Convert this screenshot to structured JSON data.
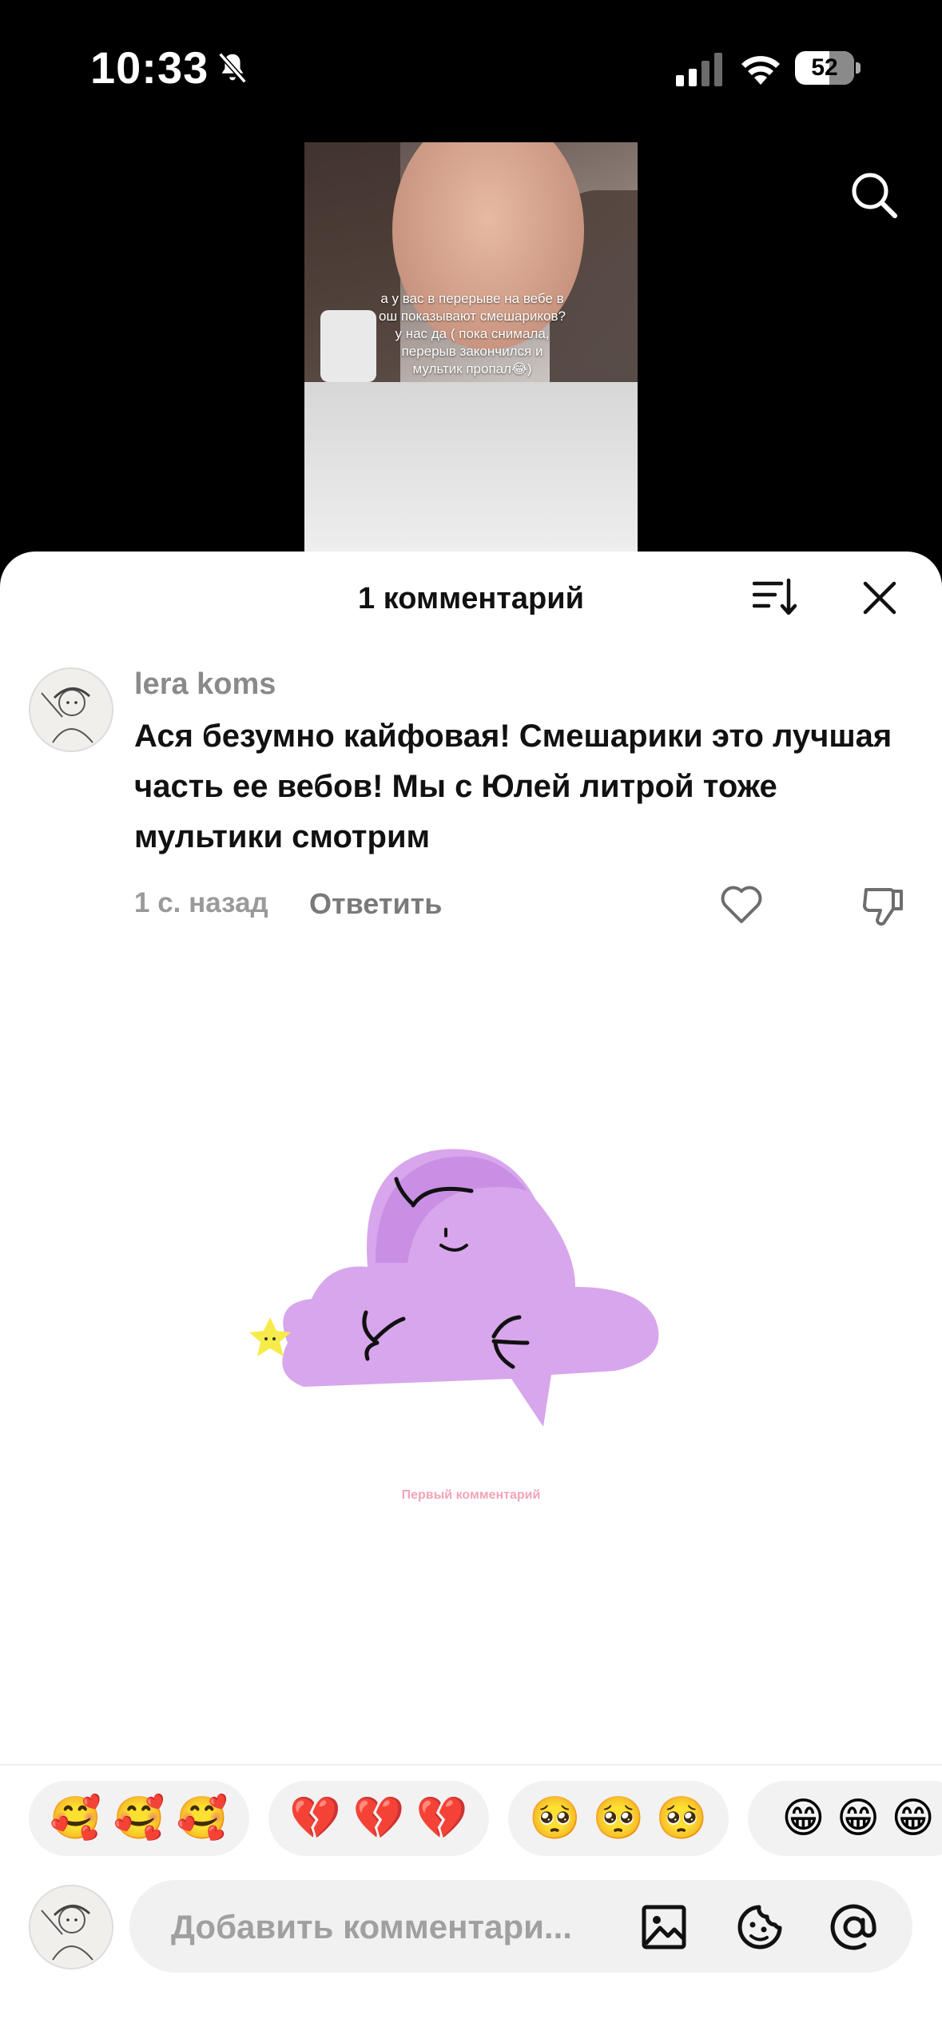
{
  "status_bar": {
    "time": "10:33",
    "battery": "52"
  },
  "video": {
    "caption": "а у вас в перерыве на вебе в ош показывают смешариков? у нас да ( пока снимала, перерыв закончился и мультик пропал😂)"
  },
  "comments_sheet": {
    "title": "1 комментарий",
    "comments": [
      {
        "username": "lera koms",
        "text": "Ася безумно кайфовая! Смешарики это лучшая часть ее вебов! Мы с Юлей литрой тоже мультики смотрим",
        "time": "1 с. назад",
        "reply_label": "Ответить"
      }
    ],
    "first_comment_label": "Первый комментарий"
  },
  "emoji_suggestions": [
    "🥰 🥰 🥰",
    "💔 💔 💔",
    "🥺 🥺 🥺",
    "😁 😁 😁"
  ],
  "composer": {
    "placeholder": "Добавить комментари..."
  },
  "icons": {
    "mute": "bell-slash-icon",
    "search": "search-icon",
    "sort": "sort-icon",
    "close": "close-icon",
    "like": "heart-icon",
    "dislike": "thumbs-down-icon",
    "image": "image-icon",
    "sticker": "sticker-icon",
    "mention": "at-icon"
  }
}
